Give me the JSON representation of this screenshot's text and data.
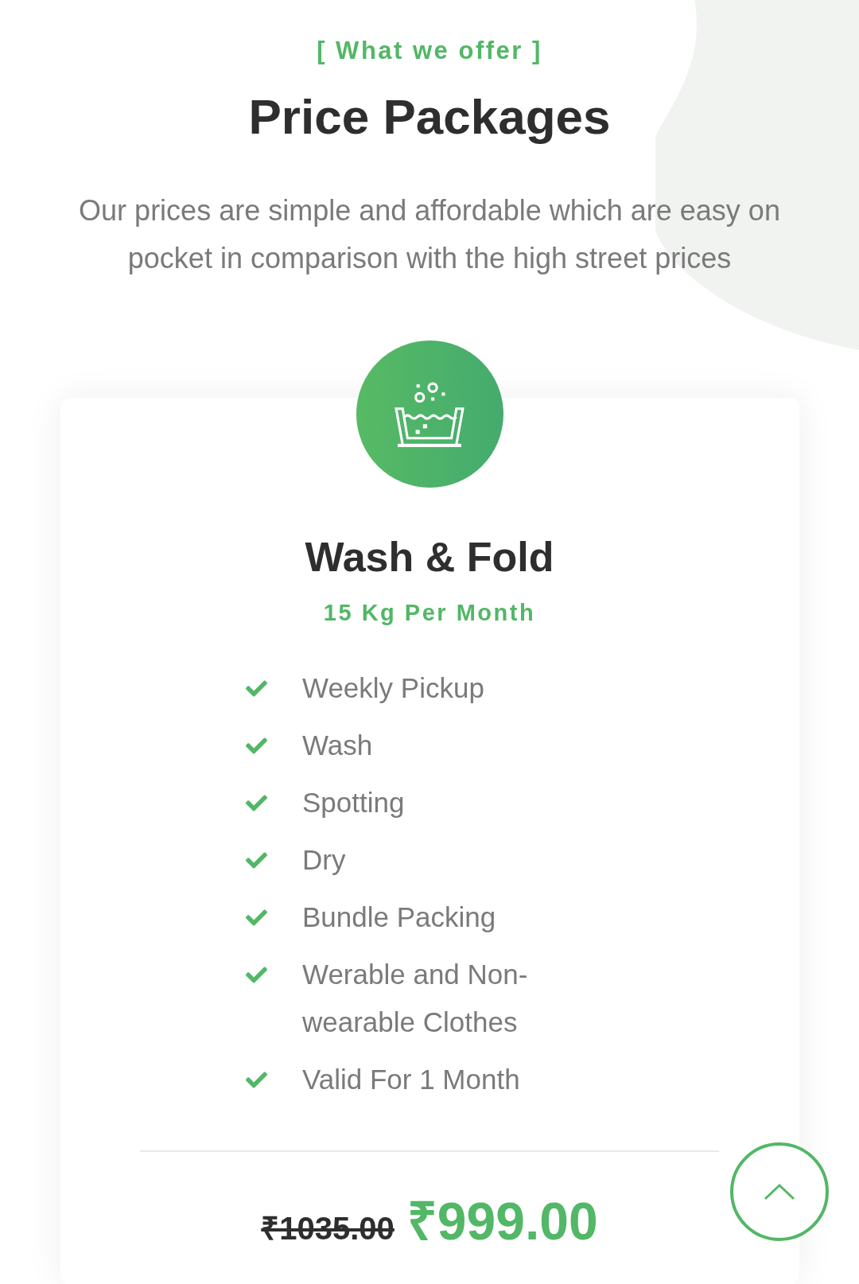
{
  "header": {
    "eyebrow": "[ What we offer ]",
    "title": "Price Packages",
    "description": "Our prices are simple and affordable which are easy on pocket in comparison with the high street prices"
  },
  "package": {
    "title": "Wash & Fold",
    "subtitle": "15 Kg Per Month",
    "features": [
      "Weekly Pickup",
      "Wash",
      "Spotting",
      "Dry",
      "Bundle Packing",
      "Werable and Non-wearable Clothes",
      "Valid For 1 Month"
    ],
    "old_price": "₹1035.00",
    "price": "₹999.00"
  }
}
